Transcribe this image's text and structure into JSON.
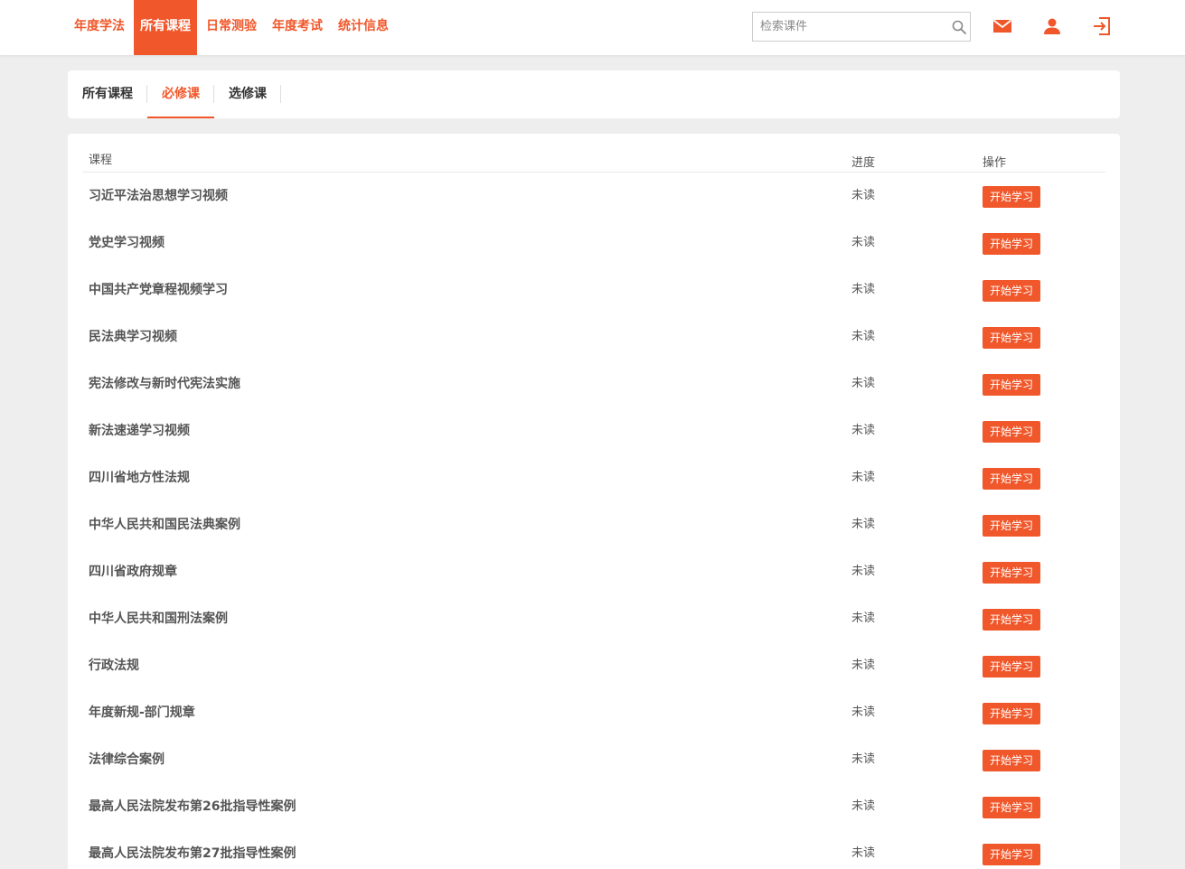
{
  "colors": {
    "accent": "#f0572a",
    "background": "#eeeeee",
    "card": "#ffffff"
  },
  "nav": {
    "items": [
      {
        "label": "年度学法",
        "active": false
      },
      {
        "label": "所有课程",
        "active": true
      },
      {
        "label": "日常测验",
        "active": false
      },
      {
        "label": "年度考试",
        "active": false
      },
      {
        "label": "统计信息",
        "active": false
      }
    ]
  },
  "search": {
    "placeholder": "检索课件",
    "value": "",
    "icon": "search-icon"
  },
  "header_icons": [
    "mail-icon",
    "user-icon",
    "logout-icon"
  ],
  "tabs": [
    {
      "label": "所有课程",
      "active": false
    },
    {
      "label": "必修课",
      "active": true
    },
    {
      "label": "选修课",
      "active": false
    }
  ],
  "table": {
    "columns": {
      "course": "课程",
      "progress": "进度",
      "action": "操作"
    },
    "rows": [
      {
        "name": "习近平法治思想学习视频",
        "progress": "未读",
        "action": "开始学习"
      },
      {
        "name": "党史学习视频",
        "progress": "未读",
        "action": "开始学习"
      },
      {
        "name": "中国共产党章程视频学习",
        "progress": "未读",
        "action": "开始学习"
      },
      {
        "name": "民法典学习视频",
        "progress": "未读",
        "action": "开始学习"
      },
      {
        "name": "宪法修改与新时代宪法实施",
        "progress": "未读",
        "action": "开始学习"
      },
      {
        "name": "新法速递学习视频",
        "progress": "未读",
        "action": "开始学习"
      },
      {
        "name": "四川省地方性法规",
        "progress": "未读",
        "action": "开始学习"
      },
      {
        "name": "中华人民共和国民法典案例",
        "progress": "未读",
        "action": "开始学习"
      },
      {
        "name": "四川省政府规章",
        "progress": "未读",
        "action": "开始学习"
      },
      {
        "name": "中华人民共和国刑法案例",
        "progress": "未读",
        "action": "开始学习"
      },
      {
        "name": "行政法规",
        "progress": "未读",
        "action": "开始学习"
      },
      {
        "name": "年度新规-部门规章",
        "progress": "未读",
        "action": "开始学习"
      },
      {
        "name": "法律综合案例",
        "progress": "未读",
        "action": "开始学习"
      },
      {
        "name": "最高人民法院发布第26批指导性案例",
        "progress": "未读",
        "action": "开始学习"
      },
      {
        "name": "最高人民法院发布第27批指导性案例",
        "progress": "未读",
        "action": "开始学习"
      }
    ]
  }
}
